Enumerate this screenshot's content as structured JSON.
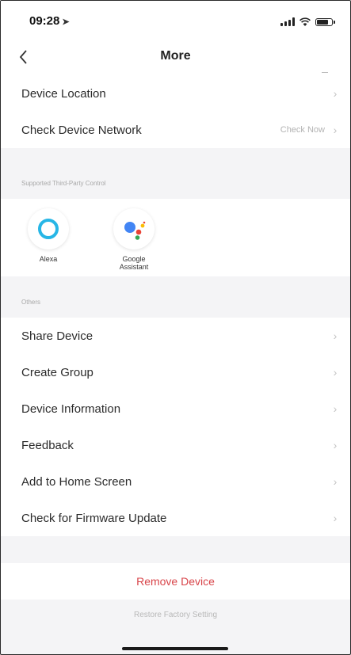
{
  "status_bar": {
    "time": "09:28",
    "location_arrow": "➤"
  },
  "nav": {
    "title": "More",
    "back_icon": "chevron-left-icon"
  },
  "top_rows": [
    {
      "label": "Device Location",
      "value": ""
    },
    {
      "label": "Check Device Network",
      "value": "Check Now"
    }
  ],
  "third_party": {
    "header": "Supported Third-Party Control",
    "items": [
      {
        "label_line1": "Alexa",
        "label_line2": "",
        "icon": "alexa-icon"
      },
      {
        "label_line1": "Google",
        "label_line2": "Assistant",
        "icon": "google-assistant-icon"
      }
    ]
  },
  "others": {
    "header": "Others",
    "rows": [
      {
        "label": "Share Device"
      },
      {
        "label": "Create Group"
      },
      {
        "label": "Device Information"
      },
      {
        "label": "Feedback"
      },
      {
        "label": "Add to Home Screen"
      },
      {
        "label": "Check for Firmware Update"
      }
    ]
  },
  "actions": {
    "remove_device": "Remove Device",
    "restore_factory": "Restore Factory Setting"
  },
  "colors": {
    "accent_red": "#d8454a",
    "alexa_blue": "#27b6e6",
    "google_blue": "#4285f4",
    "google_red": "#ea4335",
    "google_yellow": "#fbbc05",
    "google_green": "#34a853"
  },
  "chevron": "›"
}
